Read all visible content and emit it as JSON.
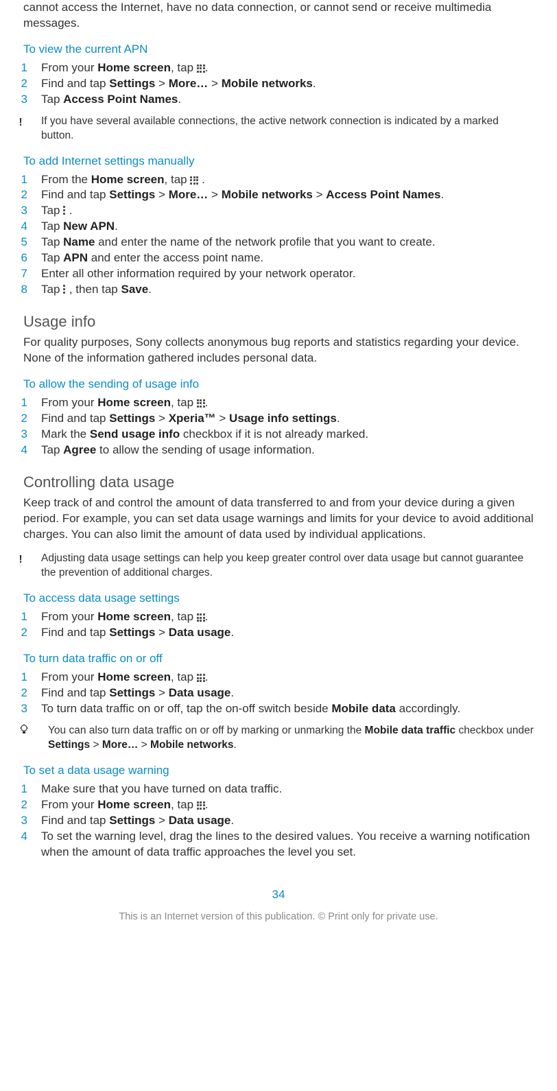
{
  "intro_fragment": "cannot access the Internet, have no data connection, or cannot send or receive multimedia messages.",
  "sec_view_apn": {
    "heading": "To view the current APN",
    "steps": [
      {
        "pre": "From your ",
        "b1": "Home screen",
        "mid": ", tap ",
        "icon": "grid",
        "post": "."
      },
      {
        "full_html": "Find and tap <b>Settings</b> > <b>More…</b> > <b>Mobile networks</b>."
      },
      {
        "full_html": "Tap <b>Access Point Names</b>."
      }
    ],
    "note": "If you have several available connections, the active network connection is indicated by a marked button."
  },
  "sec_add_internet": {
    "heading": "To add Internet settings manually",
    "steps": [
      {
        "pre": "From the ",
        "b1": "Home screen",
        "mid": ", tap ",
        "icon": "grid",
        "post": " ."
      },
      {
        "full_html": "Find and tap <b>Settings</b> > <b>More…</b> > <b>Mobile networks</b> > <b>Access Point Names</b>."
      },
      {
        "pre": "Tap ",
        "icon": "dots",
        "post": " ."
      },
      {
        "full_html": "Tap <b>New APN</b>."
      },
      {
        "full_html": "Tap <b>Name</b> and enter the name of the network profile that you want to create."
      },
      {
        "full_html": "Tap <b>APN</b> and enter the access point name."
      },
      {
        "full_html": "Enter all other information required by your network operator."
      },
      {
        "pre": "Tap ",
        "icon": "dots",
        "mid": " , then tap ",
        "b1": "Save",
        "post": "."
      }
    ]
  },
  "sec_usage_info": {
    "heading": "Usage info",
    "body": "For quality purposes, Sony collects anonymous bug reports and statistics regarding your device. None of the information gathered includes personal data."
  },
  "sec_allow_usage": {
    "heading": "To allow the sending of usage info",
    "steps": [
      {
        "pre": "From your ",
        "b1": "Home screen",
        "mid": ", tap ",
        "icon": "grid",
        "post": "."
      },
      {
        "full_html": "Find and tap <b>Settings</b> > <b>Xperia™</b> > <b>Usage info settings</b>."
      },
      {
        "full_html": "Mark the <b>Send usage info</b> checkbox if it is not already marked."
      },
      {
        "full_html": "Tap <b>Agree</b> to allow the sending of usage information."
      }
    ]
  },
  "sec_controlling": {
    "heading": "Controlling data usage",
    "body": "Keep track of and control the amount of data transferred to and from your device during a given period. For example, you can set data usage warnings and limits for your device to avoid additional charges. You can also limit the amount of data used by individual applications.",
    "note": "Adjusting data usage settings can help you keep greater control over data usage but cannot guarantee the prevention of additional charges."
  },
  "sec_access_data": {
    "heading": "To access data usage settings",
    "steps": [
      {
        "pre": "From your ",
        "b1": "Home screen",
        "mid": ", tap ",
        "icon": "grid",
        "post": "."
      },
      {
        "full_html": "Find and tap <b>Settings</b> > <b>Data usage</b>."
      }
    ]
  },
  "sec_turn_traffic": {
    "heading": "To turn data traffic on or off",
    "steps": [
      {
        "pre": "From your ",
        "b1": "Home screen",
        "mid": ", tap ",
        "icon": "grid",
        "post": "."
      },
      {
        "full_html": "Find and tap <b>Settings</b> > <b>Data usage</b>."
      },
      {
        "full_html": "To turn data traffic on or off, tap the on-off switch beside <b>Mobile data</b> accordingly."
      }
    ],
    "tip_html": "You can also turn data traffic on or off by marking or unmarking the <b>Mobile data traffic</b> checkbox under <b>Settings</b> > <b>More…</b> > <b>Mobile networks</b>."
  },
  "sec_set_warning": {
    "heading": "To set a data usage warning",
    "steps": [
      {
        "full_html": "Make sure that you have turned on data traffic."
      },
      {
        "pre": "From your ",
        "b1": "Home screen",
        "mid": ", tap ",
        "icon": "grid",
        "post": "."
      },
      {
        "full_html": "Find and tap <b>Settings</b> > <b>Data usage</b>."
      },
      {
        "full_html": "To set the warning level, drag the lines to the desired values. You receive a warning notification when the amount of data traffic approaches the level you set."
      }
    ]
  },
  "page_number": "34",
  "footer": "This is an Internet version of this publication. © Print only for private use."
}
